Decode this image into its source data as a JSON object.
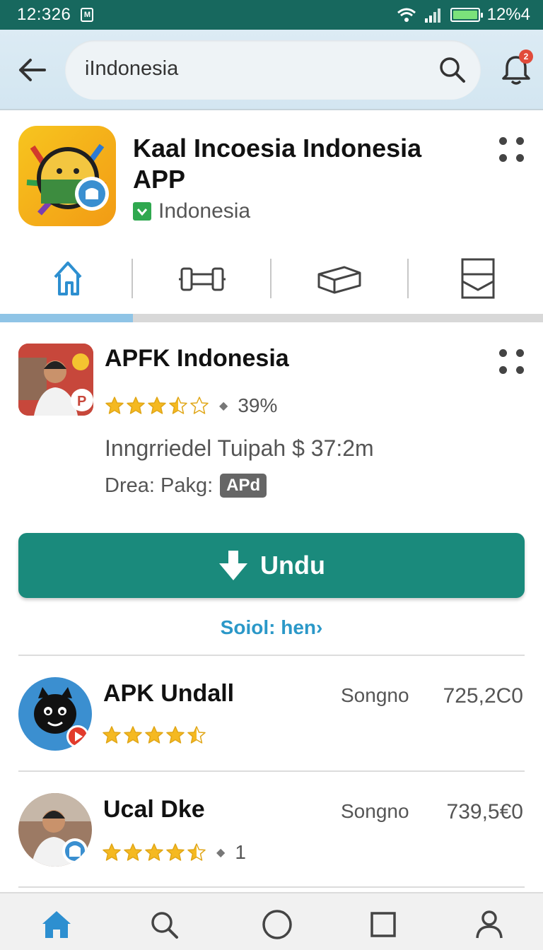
{
  "status_bar": {
    "time": "12:326",
    "notification": "M",
    "battery": "12%4"
  },
  "search": {
    "value": "iIndonesia",
    "bell_badge": "2"
  },
  "app": {
    "title": "Kaal Incoesia Indonesia APP",
    "publisher": "Indonesia"
  },
  "tabs": [
    {
      "icon": "home-icon",
      "active": true
    },
    {
      "icon": "dumbbell-icon"
    },
    {
      "icon": "box-icon"
    },
    {
      "icon": "mailbox-icon"
    }
  ],
  "featured": {
    "title": "APFK Indonesia",
    "rating_stars": 3.5,
    "rating_text": "39%",
    "meta": "Inngrriedel Tuipah $ 37:2m",
    "pkg_label": "Drea: Pakg:",
    "pkg_badge": "APd",
    "download_label": "Undu",
    "see_more": "Soiol: hen"
  },
  "list": [
    {
      "title": "APK Undall",
      "developer": "Songno",
      "count": "725,2C0",
      "rating_stars": 4.5,
      "rating_extra": ""
    },
    {
      "title": "Ucal Dke",
      "developer": "Songno",
      "count": "739,5€0",
      "rating_stars": 4.5,
      "rating_extra": "1"
    }
  ],
  "bottom_nav": [
    "home-icon",
    "search-icon",
    "circle-icon",
    "square-icon",
    "profile-icon"
  ],
  "colors": {
    "status_bar": "#17685e",
    "accent": "#1a8a7c",
    "link": "#2b98c8",
    "star": "#f5b921"
  }
}
